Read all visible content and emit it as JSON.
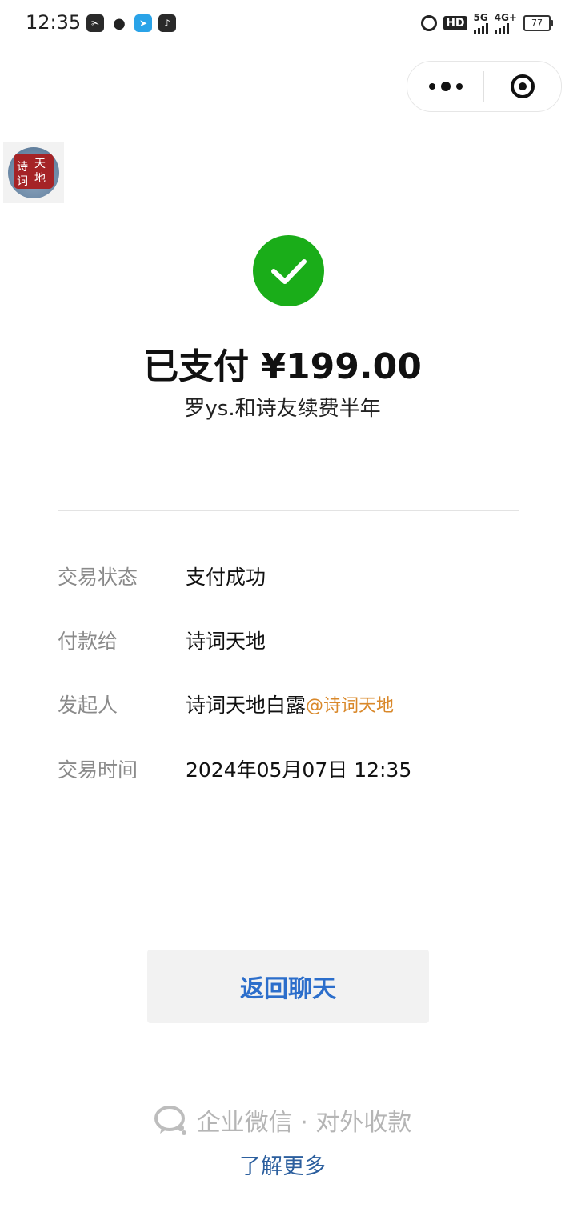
{
  "status_bar": {
    "time": "12:35",
    "left_icons": [
      "scissors-icon",
      "wechat-icon",
      "telegram-icon",
      "music-icon"
    ],
    "hd_label": "HD",
    "net_5g": "5G",
    "net_4g": "4G+",
    "battery": "77"
  },
  "capsule": {
    "more_icon": "more-dots-icon",
    "close_icon": "target-close-icon"
  },
  "logo": {
    "chars": [
      "诗",
      "词",
      "天",
      "地"
    ]
  },
  "payment": {
    "title": "已支付 ¥199.00",
    "description": "罗ys.和诗友续费半年"
  },
  "details": [
    {
      "label": "交易状态",
      "value": "支付成功"
    },
    {
      "label": "付款给",
      "value": "诗词天地"
    },
    {
      "label": "发起人",
      "value": "诗词天地白露",
      "suffix": "@诗词天地"
    },
    {
      "label": "交易时间",
      "value": "2024年05月07日 12:35"
    }
  ],
  "back_button": "返回聊天",
  "footer": {
    "brand": "企业微信 · 对外收款",
    "learn_more": "了解更多"
  },
  "colors": {
    "success_green": "#1aad19",
    "link_blue": "#2c6ecb",
    "mention_orange": "#d9882a"
  }
}
